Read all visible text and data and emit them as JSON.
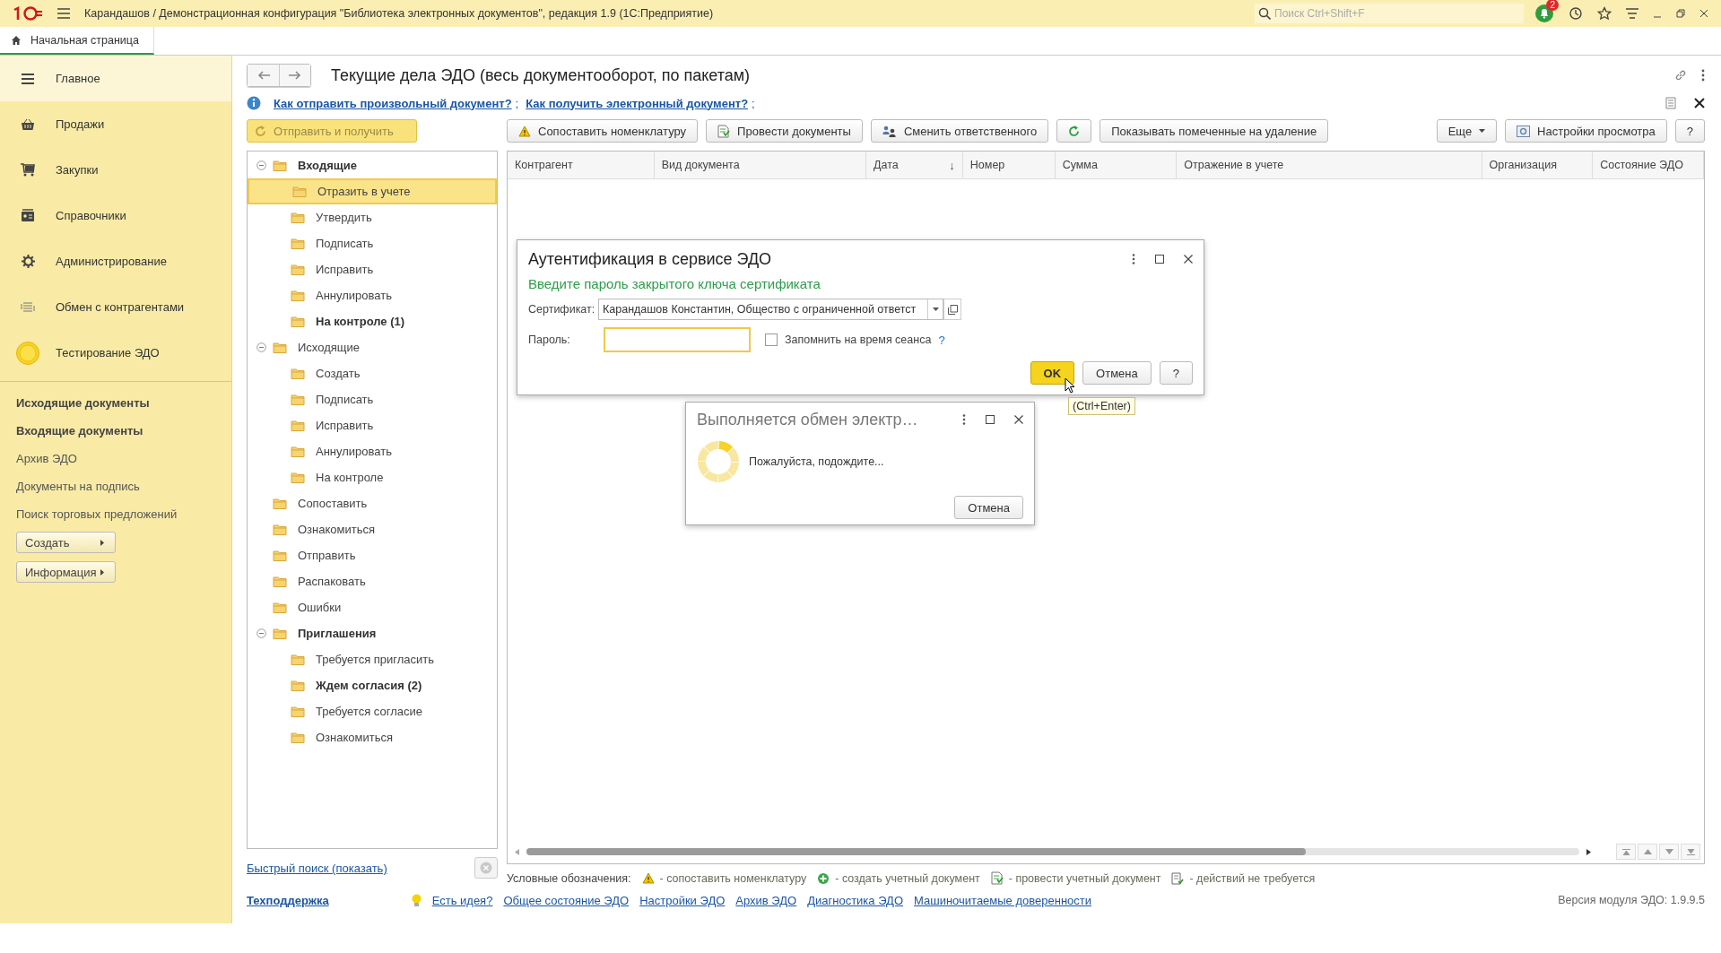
{
  "window": {
    "title": "Карандашов / Демонстрационная конфигурация \"Библиотека электронных документов\", редакция 1.9  (1С:Предприятие)"
  },
  "search": {
    "placeholder": "Поиск Ctrl+Shift+F"
  },
  "notifications": {
    "badge": "2"
  },
  "tabs": [
    {
      "label": "Начальная страница",
      "selected": true
    }
  ],
  "sidebar": {
    "sections": [
      {
        "label": "Главное",
        "selected": true
      },
      {
        "label": "Продажи",
        "selected": false
      },
      {
        "label": "Закупки",
        "selected": false
      },
      {
        "label": "Справочники",
        "selected": false
      },
      {
        "label": "Администрирование",
        "selected": false
      },
      {
        "label": "Обмен с контрагентами",
        "selected": false
      },
      {
        "label": "Тестирование ЭДО",
        "selected": false
      }
    ],
    "links": [
      {
        "label": "Исходящие документы",
        "bold": true
      },
      {
        "label": "Входящие документы",
        "bold": true
      },
      {
        "label": "Архив ЭДО",
        "bold": false
      },
      {
        "label": "Документы на подпись",
        "bold": false
      },
      {
        "label": "Поиск торговых предложений",
        "bold": false
      }
    ],
    "buttons": [
      "Создать",
      "Информация"
    ]
  },
  "page": {
    "title": "Текущие дела ЭДО (весь документооборот, по пакетам)",
    "help_links": [
      "Как отправить произвольный документ?",
      "Как получить электронный документ?"
    ],
    "help_separator": ";",
    "send_button": "Отправить и получить",
    "toolbar": [
      {
        "kind": "button",
        "label": "Сопоставить номенклатуру"
      },
      {
        "kind": "button",
        "label": "Провести документы"
      },
      {
        "kind": "button",
        "label": "Сменить ответственного"
      },
      {
        "kind": "icon_button"
      },
      {
        "kind": "button",
        "label": "Показывать помеченные на удаление"
      },
      {
        "kind": "spacer"
      },
      {
        "kind": "menu_button",
        "label": "Еще"
      },
      {
        "kind": "button",
        "label": "Настройки просмотра"
      },
      {
        "kind": "button",
        "label": "?"
      }
    ],
    "tree": [
      {
        "label": "Входящие",
        "bold": true,
        "selected": false,
        "expanded": true,
        "children": [
          {
            "label": "Отразить в учете",
            "bold": false,
            "selected": true
          },
          {
            "label": "Утвердить",
            "bold": false,
            "selected": false
          },
          {
            "label": "Подписать",
            "bold": false,
            "selected": false
          },
          {
            "label": "Исправить",
            "bold": false,
            "selected": false
          },
          {
            "label": "Аннулировать",
            "bold": false,
            "selected": false
          },
          {
            "label": "На контроле (1)",
            "bold": true,
            "selected": false
          }
        ]
      },
      {
        "label": "Исходящие",
        "bold": false,
        "selected": false,
        "expanded": true,
        "children": [
          {
            "label": "Создать",
            "bold": false,
            "selected": false
          },
          {
            "label": "Подписать",
            "bold": false,
            "selected": false
          },
          {
            "label": "Исправить",
            "bold": false,
            "selected": false
          },
          {
            "label": "Аннулировать",
            "bold": false,
            "selected": false
          },
          {
            "label": "На контроле",
            "bold": false,
            "selected": false
          }
        ]
      },
      {
        "label": "Сопоставить",
        "bold": false,
        "selected": false
      },
      {
        "label": "Ознакомиться",
        "bold": false,
        "selected": false
      },
      {
        "label": "Отправить",
        "bold": false,
        "selected": false
      },
      {
        "label": "Распаковать",
        "bold": false,
        "selected": false
      },
      {
        "label": "Ошибки",
        "bold": false,
        "selected": false
      },
      {
        "label": "Приглашения",
        "bold": true,
        "selected": false,
        "expanded": true,
        "children": [
          {
            "label": "Требуется пригласить",
            "bold": false,
            "selected": false
          },
          {
            "label": "Ждем согласия (2)",
            "bold": true,
            "selected": false
          },
          {
            "label": "Требуется согласие",
            "bold": false,
            "selected": false
          },
          {
            "label": "Ознакомиться",
            "bold": false,
            "selected": false
          }
        ]
      }
    ],
    "table": {
      "columns": [
        {
          "label": "Контрагент"
        },
        {
          "label": "Вид документа"
        },
        {
          "label": "Дата",
          "sort_mark": "↓"
        },
        {
          "label": "Номер"
        },
        {
          "label": "Сумма"
        },
        {
          "label": "Отражение в учете"
        },
        {
          "label": "Организация"
        },
        {
          "label": "Состояние ЭДО"
        }
      ]
    },
    "quick_search": "Быстрый поиск (показать)",
    "legend": {
      "label": "Условные обозначения:",
      "items": [
        "- сопоставить номенклатуру",
        "- создать учетный документ",
        "- провести учетный документ",
        "- действий не требуется"
      ]
    },
    "support_link": "Техподдержка",
    "footer_links": [
      "Есть идея?",
      "Общее состояние ЭДО",
      "Настройки ЭДО",
      "Архив ЭДО",
      "Диагностика ЭДО",
      "Машиночитаемые доверенности"
    ],
    "version": "Версия модуля ЭДО: 1.9.9.5"
  },
  "auth_dialog": {
    "title": "Аутентификация в сервисе ЭДО",
    "prompt": "Введите пароль закрытого ключа сертификата",
    "certificate_label": "Сертификат:",
    "certificate_value": "Карандашов Константин, Общество с ограниченной ответст",
    "password_label": "Пароль:",
    "remember_label": "Запомнить на время сеанса",
    "remember_checked": false,
    "help_mark": "?",
    "buttons": [
      {
        "label": "OK",
        "default": true
      },
      {
        "label": "Отмена",
        "default": false
      },
      {
        "label": "?",
        "default": false
      }
    ]
  },
  "progress_dialog": {
    "title": "Выполняется обмен электр…",
    "message": "Пожалуйста, подождите...",
    "button": "Отмена"
  },
  "tooltip": "(Ctrl+Enter)"
}
